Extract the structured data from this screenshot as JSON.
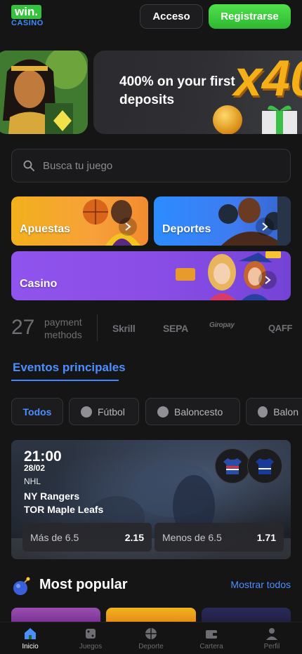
{
  "header": {
    "logo_top": "win.",
    "logo_bottom": "CASINO",
    "login_label": "Acceso",
    "register_label": "Registrarse"
  },
  "promo": {
    "text": "400% on your first deposits",
    "badge": "x40"
  },
  "search": {
    "placeholder": "Busca tu juego"
  },
  "categories": [
    {
      "label": "Apuestas"
    },
    {
      "label": "Deportes"
    },
    {
      "label": "Casino"
    }
  ],
  "payments": {
    "count": "27",
    "label_line1": "payment",
    "label_line2": "methods",
    "brands": [
      "Skrill",
      "SEPA",
      "Giropay",
      "QAFF"
    ]
  },
  "events": {
    "title": "Eventos principales",
    "tabs": [
      {
        "label": "Todos",
        "icon": "none"
      },
      {
        "label": "Fútbol",
        "icon": "soccer-ball-icon"
      },
      {
        "label": "Baloncesto",
        "icon": "basketball-icon"
      },
      {
        "label": "Balon",
        "icon": "basketball-icon"
      }
    ],
    "featured": {
      "time": "21:00",
      "date": "28/02",
      "league": "NHL",
      "team_home": "NY Rangers",
      "team_away": "TOR Maple Leafs",
      "odds": [
        {
          "label": "Más de 6.5",
          "value": "2.15"
        },
        {
          "label": "Menos de 6.5",
          "value": "1.71"
        }
      ]
    }
  },
  "most_popular": {
    "title": "Most popular",
    "link": "Mostrar todos"
  },
  "nav": [
    {
      "label": "Inicio",
      "icon": "home-icon",
      "active": true
    },
    {
      "label": "Juegos",
      "icon": "dice-icon"
    },
    {
      "label": "Deporte",
      "icon": "basketball-icon"
    },
    {
      "label": "Cartera",
      "icon": "wallet-icon"
    },
    {
      "label": "Perfil",
      "icon": "user-icon"
    }
  ],
  "colors": {
    "background": "#151516",
    "accent_blue": "#4d8eff",
    "register_green": "#35c23c",
    "promo_gold": "#f5b019"
  }
}
